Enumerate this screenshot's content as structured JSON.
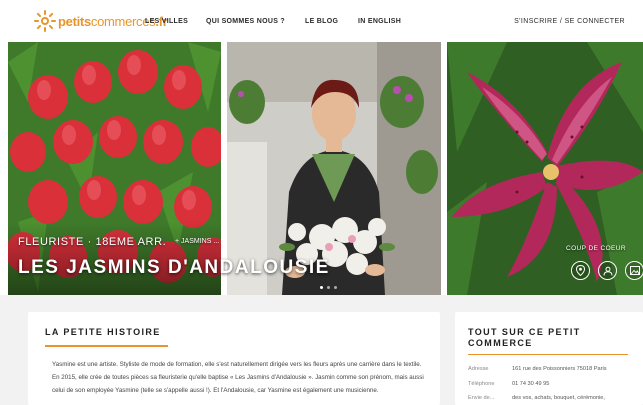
{
  "header": {
    "logo_text_a": "petits",
    "logo_text_b": "commerces",
    "logo_text_c": ".fr",
    "nav": [
      "LES VILLES",
      "QUI SOMMES NOUS ?",
      "LE BLOG",
      "IN ENGLISH"
    ],
    "auth": "S'INSCRIRE / SE CONNECTER"
  },
  "hero": {
    "category": "FLEURISTE · 18EME ARR.",
    "tag": "+ JASMINS ...",
    "title": "LES JASMINS D'ANDALOUSIE",
    "coup": "COUP DE COEUR",
    "dots": 3,
    "active_dot": 0
  },
  "story": {
    "heading": "LA PETITE HISTOIRE",
    "text": "Yasmine est une artiste. Styliste de mode de formation, elle s'est naturellement dirigée vers les fleurs après une carrière dans le textile. En 2015, elle crée de toutes pièces sa fleuristerie qu'elle baptise « Les Jasmins d'Andalousie ». Jasmin comme son prénom, mais aussi celui de son employée Yasmine (telle se s'appelle aussi !). Et l'Andalousie, car Yasmine est également une musicienne."
  },
  "info": {
    "heading": "TOUT SUR CE PETIT COMMERCE",
    "rows": [
      {
        "key": "Adresse",
        "value": "161 rue des Poissonniers 75018 Paris"
      },
      {
        "key": "Téléphone",
        "value": "01 74 30 49 95"
      },
      {
        "key": "Envie de...",
        "value": "des vos, achats, bouquet, cérémonie,"
      }
    ]
  },
  "colors": {
    "accent": "#e8962b",
    "lower_bg": "#f2f2f2"
  }
}
